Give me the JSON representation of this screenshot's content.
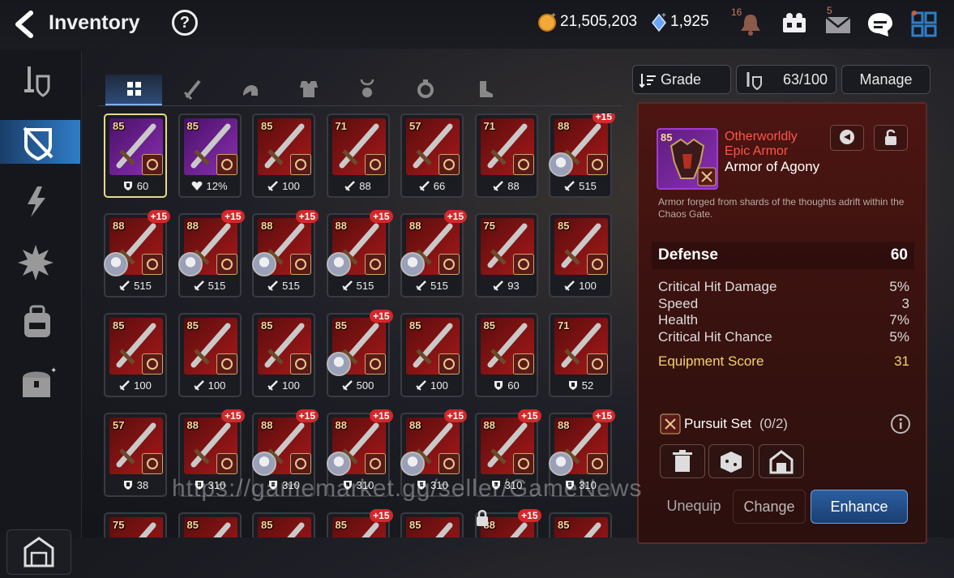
{
  "header": {
    "title": "Inventory",
    "help_label": "?",
    "gold": "21,505,203",
    "crystals": "1,925",
    "notif_count": "16",
    "mail_count": "5"
  },
  "sidebar": {
    "items": [
      "weapon-armor-icon",
      "equipment-shield-icon",
      "artifact-icon",
      "catalyst-icon",
      "bag-icon",
      "chest-icon"
    ],
    "bottom": "storage-icon"
  },
  "tabs": [
    "all",
    "weapon",
    "helmet",
    "armor",
    "necklace",
    "ring",
    "boots"
  ],
  "toolbar": {
    "grade_label": "Grade",
    "capacity": "63/100",
    "manage_label": "Manage"
  },
  "items": [
    {
      "lvl": "85",
      "stat": "60",
      "stat_icon": "shield",
      "plus": "",
      "hero": false,
      "color": "purple",
      "selected": true
    },
    {
      "lvl": "85",
      "stat": "12%",
      "stat_icon": "heart",
      "plus": "",
      "hero": false,
      "color": "purple"
    },
    {
      "lvl": "85",
      "stat": "100",
      "stat_icon": "sword",
      "plus": "",
      "hero": false,
      "color": "red"
    },
    {
      "lvl": "71",
      "stat": "88",
      "stat_icon": "sword",
      "plus": "",
      "hero": false,
      "color": "red"
    },
    {
      "lvl": "57",
      "stat": "66",
      "stat_icon": "sword",
      "plus": "",
      "hero": false,
      "color": "red"
    },
    {
      "lvl": "71",
      "stat": "88",
      "stat_icon": "sword",
      "plus": "",
      "hero": false,
      "color": "red"
    },
    {
      "lvl": "88",
      "stat": "515",
      "stat_icon": "sword",
      "plus": "+15",
      "hero": true,
      "color": "red"
    },
    {
      "lvl": "88",
      "stat": "515",
      "stat_icon": "sword",
      "plus": "+15",
      "hero": true,
      "color": "red"
    },
    {
      "lvl": "88",
      "stat": "515",
      "stat_icon": "sword",
      "plus": "+15",
      "hero": true,
      "color": "red"
    },
    {
      "lvl": "88",
      "stat": "515",
      "stat_icon": "sword",
      "plus": "+15",
      "hero": true,
      "color": "red"
    },
    {
      "lvl": "88",
      "stat": "515",
      "stat_icon": "sword",
      "plus": "+15",
      "hero": true,
      "color": "red"
    },
    {
      "lvl": "88",
      "stat": "515",
      "stat_icon": "sword",
      "plus": "+15",
      "hero": true,
      "color": "red"
    },
    {
      "lvl": "75",
      "stat": "93",
      "stat_icon": "sword",
      "plus": "",
      "hero": false,
      "color": "red"
    },
    {
      "lvl": "85",
      "stat": "100",
      "stat_icon": "sword",
      "plus": "",
      "hero": false,
      "color": "red"
    },
    {
      "lvl": "85",
      "stat": "100",
      "stat_icon": "sword",
      "plus": "",
      "hero": false,
      "color": "red"
    },
    {
      "lvl": "85",
      "stat": "100",
      "stat_icon": "sword",
      "plus": "",
      "hero": false,
      "color": "red"
    },
    {
      "lvl": "85",
      "stat": "100",
      "stat_icon": "sword",
      "plus": "",
      "hero": false,
      "color": "red"
    },
    {
      "lvl": "85",
      "stat": "500",
      "stat_icon": "sword",
      "plus": "+15",
      "hero": true,
      "color": "red"
    },
    {
      "lvl": "85",
      "stat": "100",
      "stat_icon": "sword",
      "plus": "",
      "hero": false,
      "color": "red"
    },
    {
      "lvl": "85",
      "stat": "60",
      "stat_icon": "shield",
      "plus": "",
      "hero": false,
      "color": "red"
    },
    {
      "lvl": "71",
      "stat": "52",
      "stat_icon": "shield",
      "plus": "",
      "hero": false,
      "color": "red"
    },
    {
      "lvl": "57",
      "stat": "38",
      "stat_icon": "shield",
      "plus": "",
      "hero": false,
      "color": "red"
    },
    {
      "lvl": "88",
      "stat": "310",
      "stat_icon": "shield",
      "plus": "+15",
      "hero": false,
      "color": "red"
    },
    {
      "lvl": "88",
      "stat": "310",
      "stat_icon": "shield",
      "plus": "+15",
      "hero": true,
      "color": "red"
    },
    {
      "lvl": "88",
      "stat": "310",
      "stat_icon": "shield",
      "plus": "+15",
      "hero": true,
      "color": "red"
    },
    {
      "lvl": "88",
      "stat": "310",
      "stat_icon": "shield",
      "plus": "+15",
      "hero": true,
      "color": "red"
    },
    {
      "lvl": "88",
      "stat": "310",
      "stat_icon": "shield",
      "plus": "+15",
      "hero": false,
      "color": "red"
    },
    {
      "lvl": "88",
      "stat": "310",
      "stat_icon": "shield",
      "plus": "+15",
      "hero": true,
      "color": "red"
    },
    {
      "lvl": "75",
      "stat": "",
      "stat_icon": "",
      "plus": "",
      "hero": false,
      "color": "red"
    },
    {
      "lvl": "85",
      "stat": "",
      "stat_icon": "",
      "plus": "",
      "hero": false,
      "color": "red"
    },
    {
      "lvl": "85",
      "stat": "",
      "stat_icon": "",
      "plus": "",
      "hero": false,
      "color": "red"
    },
    {
      "lvl": "85",
      "stat": "",
      "stat_icon": "",
      "plus": "+15",
      "hero": false,
      "color": "red"
    },
    {
      "lvl": "85",
      "stat": "",
      "stat_icon": "",
      "plus": "",
      "hero": false,
      "color": "red"
    },
    {
      "lvl": "88",
      "stat": "",
      "stat_icon": "",
      "plus": "+15",
      "hero": false,
      "color": "red"
    },
    {
      "lvl": "85",
      "stat": "",
      "stat_icon": "",
      "plus": "",
      "hero": false,
      "color": "red"
    }
  ],
  "detail": {
    "level": "85",
    "grade_line1": "Otherworldly",
    "grade_line2": "Epic Armor",
    "name": "Armor of Agony",
    "description": "Armor forged from shards of the thoughts adrift within the Chaos Gate.",
    "main_stat": {
      "label": "Defense",
      "value": "60"
    },
    "substats": [
      {
        "label": "Critical Hit Damage",
        "value": "5%"
      },
      {
        "label": "Speed",
        "value": "3"
      },
      {
        "label": "Health",
        "value": "7%"
      },
      {
        "label": "Critical Hit Chance",
        "value": "5%"
      }
    ],
    "score": {
      "label": "Equipment Score",
      "value": "31"
    },
    "set": {
      "name": "Pursuit Set",
      "progress": "(0/2)"
    },
    "unequip_label": "Unequip",
    "change_label": "Change",
    "enhance_label": "Enhance"
  },
  "watermark": "https://gamemarket.gg/seller/GameNews",
  "colors": {
    "accent_blue": "#2f7ec8",
    "epic_red": "#ff5548",
    "score_gold": "#f3d36a",
    "plus_red": "#d4282b"
  }
}
